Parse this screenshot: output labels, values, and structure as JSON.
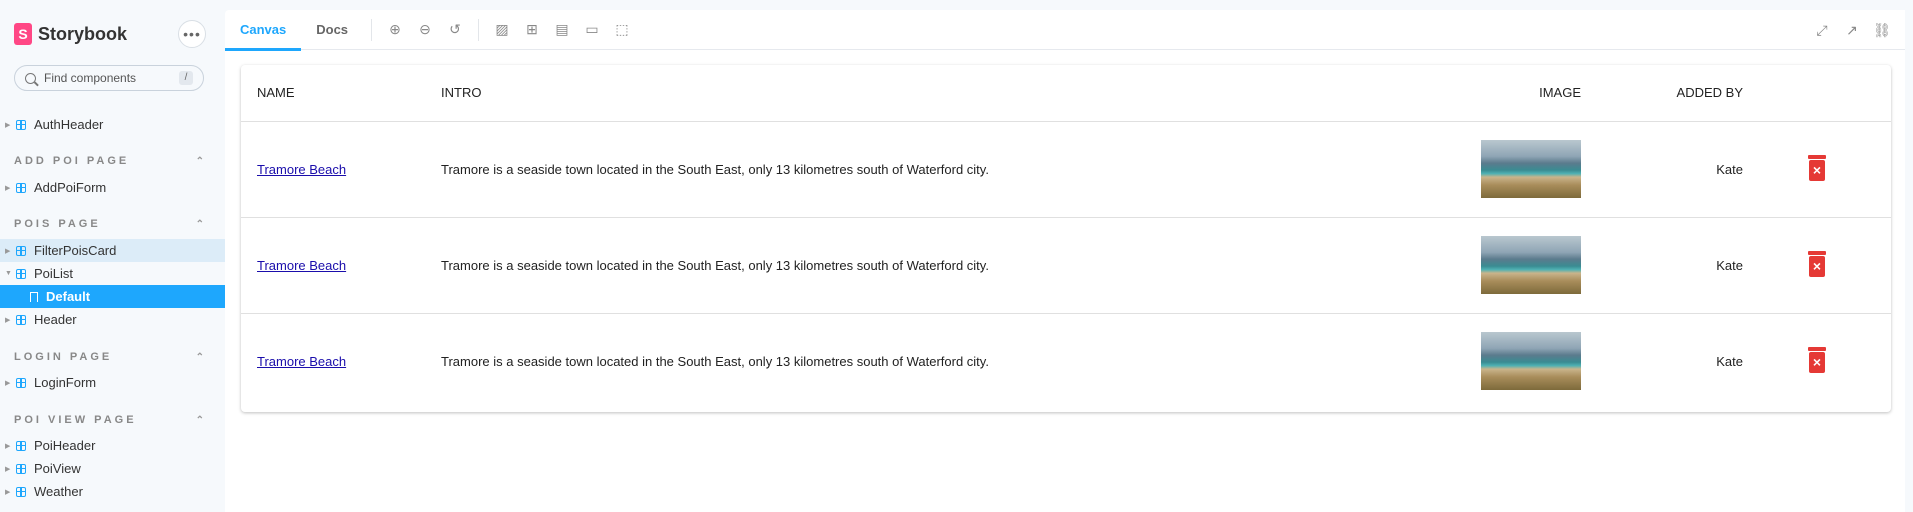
{
  "sidebar": {
    "brand": "Storybook",
    "brand_logo": "S",
    "menu_glyph": "•••",
    "search": {
      "placeholder": "Find components",
      "shortcut": "/"
    },
    "items": {
      "authheader": "AuthHeader",
      "addpoiform": "AddPoiForm",
      "filterpoiscard": "FilterPoisCard",
      "poilist": "PoiList",
      "default": "Default",
      "header": "Header",
      "loginform": "LoginForm",
      "poiheader": "PoiHeader",
      "poiview": "PoiView",
      "weather": "Weather"
    },
    "sections": {
      "add_poi_page": "ADD POI PAGE",
      "pois_page": "POIS PAGE",
      "login_page": "LOGIN PAGE",
      "poi_view_page": "POI VIEW PAGE"
    }
  },
  "toolbar": {
    "tabs": {
      "canvas": "Canvas",
      "docs": "Docs"
    }
  },
  "table": {
    "headers": {
      "name": "NAME",
      "intro": "INTRO",
      "image": "IMAGE",
      "added_by": "ADDED BY"
    },
    "rows": [
      {
        "name": "Tramore Beach",
        "intro": "Tramore is a seaside town located in the South East, only 13 kilometres south of Waterford city.",
        "added_by": "Kate"
      },
      {
        "name": "Tramore Beach",
        "intro": "Tramore is a seaside town located in the South East, only 13 kilometres south of Waterford city.",
        "added_by": "Kate"
      },
      {
        "name": "Tramore Beach",
        "intro": "Tramore is a seaside town located in the South East, only 13 kilometres south of Waterford city.",
        "added_by": "Kate"
      }
    ]
  },
  "colors": {
    "accent": "#1ea7fd",
    "brand": "#ff4785",
    "delete": "#e53935"
  }
}
